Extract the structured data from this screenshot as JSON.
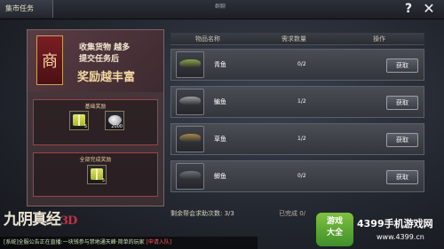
{
  "topbar": {
    "tab_label": "集市任务",
    "center_text": "群聊",
    "help_glyph": "?",
    "close_glyph": "✕"
  },
  "left_panel": {
    "flag_char": "商",
    "line1": "收集货物  越多",
    "line2": "提交任务后",
    "line3": "奖励越丰富",
    "base_reward": {
      "title": "基础奖励",
      "items": [
        {
          "icon": "gift-box-icon",
          "count": "5"
        },
        {
          "icon": "silver-coins-icon",
          "count": "2000"
        }
      ]
    },
    "full_reward": {
      "title": "全部完成奖励",
      "items": [
        {
          "icon": "gift-box-icon",
          "count": "5"
        }
      ]
    }
  },
  "table": {
    "headers": {
      "name": "物品名称",
      "need": "需求数量",
      "op": "操作"
    },
    "rows": [
      {
        "name": "青鱼",
        "progress": "0/2",
        "button": "获取",
        "icon": "green-fish-icon",
        "color": "#8ba44a"
      },
      {
        "name": "鳊鱼",
        "progress": "1/2",
        "button": "获取",
        "icon": "grey-fish-icon",
        "color": "#9b9ea3"
      },
      {
        "name": "草鱼",
        "progress": "1/2",
        "button": "获取",
        "icon": "golden-fish-icon",
        "color": "#a88a4a"
      },
      {
        "name": "鲫鱼",
        "progress": "0/2",
        "button": "获取",
        "icon": "dark-fish-icon",
        "color": "#6f7378"
      }
    ]
  },
  "footer": {
    "remaining": "剩余帮会求助次数: 3/3",
    "completed": "已完成  0/"
  },
  "logo": {
    "title": "九阴真经",
    "tag": "3D"
  },
  "chat": {
    "text": "[系统]全服公告正在直播:一块钱参与禁地通天峰·简单的玩家",
    "join": "[申请入队]"
  },
  "watermark": {
    "icon_text": "游戏\n大全",
    "text1": "4399手机游戏网",
    "text2": "www.4399.cn"
  }
}
